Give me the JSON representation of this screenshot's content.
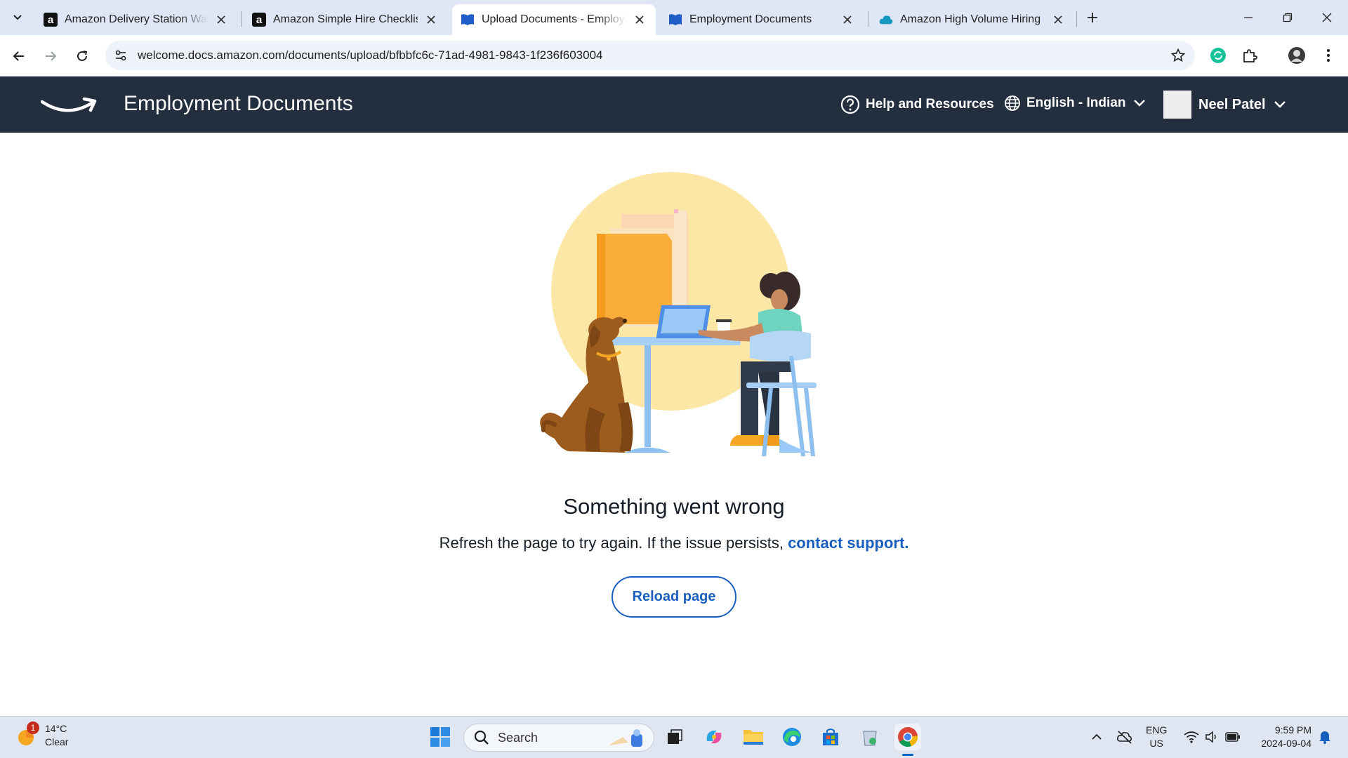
{
  "browser": {
    "tabs": [
      {
        "title": "Amazon Delivery Station Wareh",
        "favicon": "amazon-a-icon",
        "active": false
      },
      {
        "title": "Amazon Simple Hire Checklist",
        "favicon": "amazon-a-icon",
        "active": false
      },
      {
        "title": "Upload Documents - Employme",
        "favicon": "docs-icon",
        "active": true
      },
      {
        "title": "Employment Documents",
        "favicon": "docs-icon",
        "active": false
      },
      {
        "title": "Amazon High Volume Hiring",
        "favicon": "cloud-icon",
        "active": false
      }
    ],
    "url": "welcome.docs.amazon.com/documents/upload/bfbbfc6c-71ad-4981-9843-1f236f603004"
  },
  "header": {
    "title": "Employment Documents",
    "help_label": "Help and Resources",
    "language_label": "English - Indian",
    "user_name": "Neel Patel"
  },
  "error": {
    "title": "Something went wrong",
    "message": "Refresh the page to try again. If the issue persists, ",
    "link_text": "contact support.",
    "button_label": "Reload page"
  },
  "taskbar": {
    "weather_temp": "14°C",
    "weather_desc": "Clear",
    "weather_badge": "1",
    "search_label": "Search",
    "lang_line1": "ENG",
    "lang_line2": "US",
    "time": "9:59 PM",
    "date": "2024-09-04"
  },
  "colors": {
    "header_bg": "#232f3e",
    "link": "#1a5ebf",
    "tabstrip_bg": "#dfe7f6"
  }
}
